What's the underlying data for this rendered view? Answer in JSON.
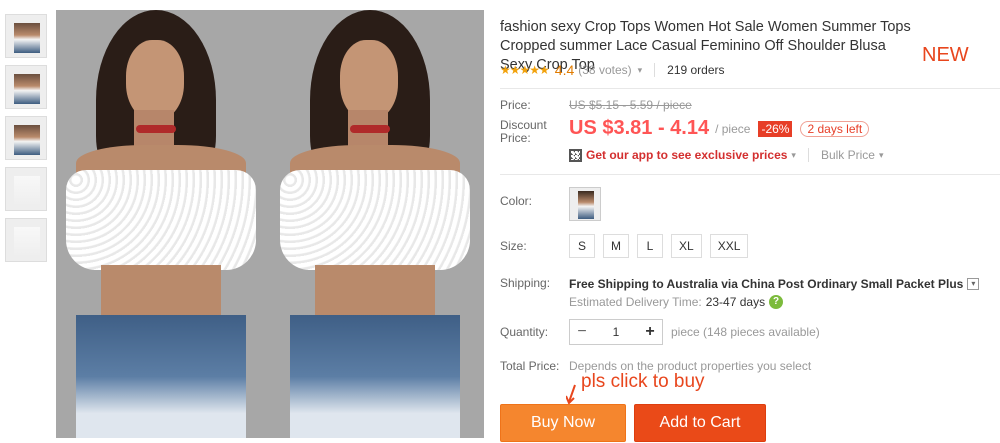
{
  "product": {
    "title": "fashion sexy Crop Tops Women Hot Sale Women Summer Tops Cropped summer Lace Casual Feminino Off Shoulder Blusa Sexy Crop Top",
    "new_tag": "NEW",
    "rating": {
      "stars": "★★★★★",
      "value": "4.4",
      "votes": "(38 votes)",
      "orders": "219 orders"
    }
  },
  "price": {
    "label": "Price:",
    "old": "US $5.15 - 5.59 / piece",
    "discount_label_1": "Discount",
    "discount_label_2": "Price:",
    "current": "US $3.81 - 4.14",
    "unit": "/ piece",
    "discount_badge": "-26%",
    "days_left": "2 days left",
    "app_link": "Get our app to see exclusive prices",
    "bulk": "Bulk Price"
  },
  "options": {
    "color_label": "Color:",
    "size_label": "Size:",
    "sizes": [
      "S",
      "M",
      "L",
      "XL",
      "XXL"
    ]
  },
  "shipping": {
    "label": "Shipping:",
    "main": "Free Shipping to Australia via China Post Ordinary Small Packet Plus",
    "estimated_label": "Estimated Delivery Time:",
    "estimated_value": "23-47 days"
  },
  "quantity": {
    "label": "Quantity:",
    "value": "1",
    "minus": "−",
    "plus": "+",
    "available": "piece (148 pieces available)"
  },
  "total": {
    "label": "Total Price:",
    "value": "Depends on the product properties you select"
  },
  "annotation": "pls click to buy",
  "buttons": {
    "buy_now": "Buy Now",
    "add_to_cart": "Add to Cart"
  },
  "colors": {
    "accent": "#f55",
    "buy_now": "#f5862e",
    "add_to_cart": "#ea4a18",
    "annotation": "#e8461d"
  }
}
